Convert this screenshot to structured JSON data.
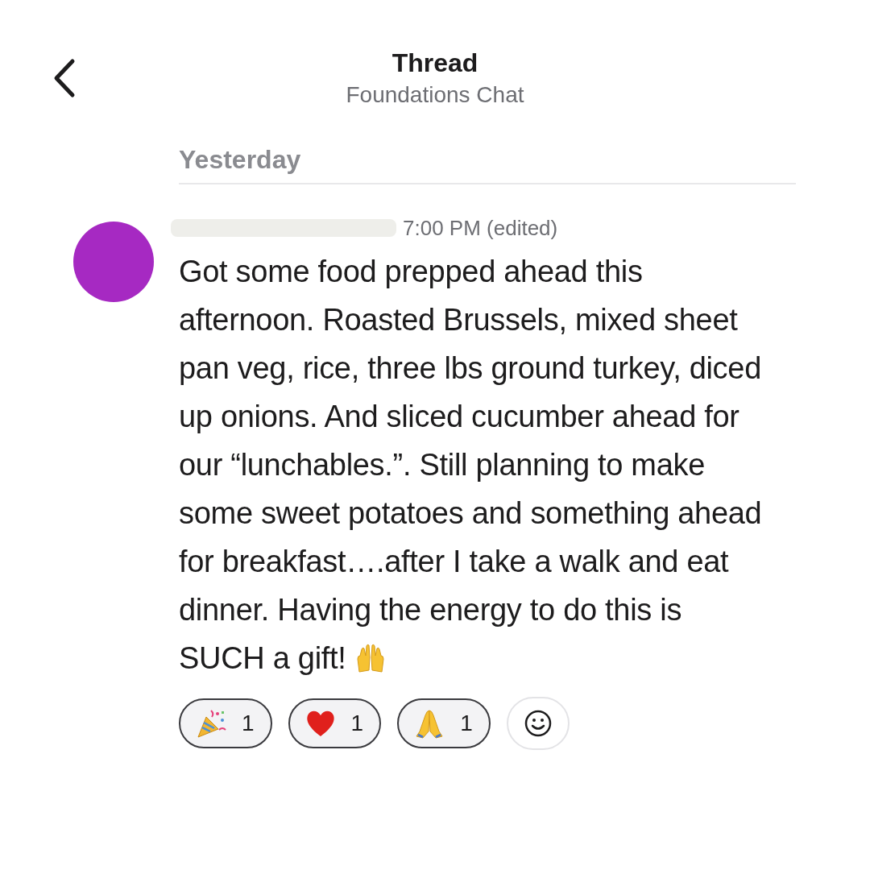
{
  "header": {
    "title": "Thread",
    "subtitle": "Foundations Chat"
  },
  "day_divider": "Yesterday",
  "message": {
    "time": "7:00 PM (edited)",
    "text": "Got some food prepped ahead this afternoon. Roasted Brussels, mixed sheet pan veg, rice, three lbs ground turkey, diced up onions. And sliced cucumber ahead for our “lunchables.”. Still planning to make some sweet potatoes and something ahead for breakfast….after I take a walk and eat dinner. Having the energy to do this is SUCH a gift!",
    "trailing_emoji": {
      "kind": "raised-hands"
    },
    "reactions": [
      {
        "kind": "party",
        "count": "1",
        "selected": true
      },
      {
        "kind": "heart",
        "count": "1",
        "selected": true
      },
      {
        "kind": "pray",
        "count": "1",
        "selected": true
      }
    ]
  }
}
